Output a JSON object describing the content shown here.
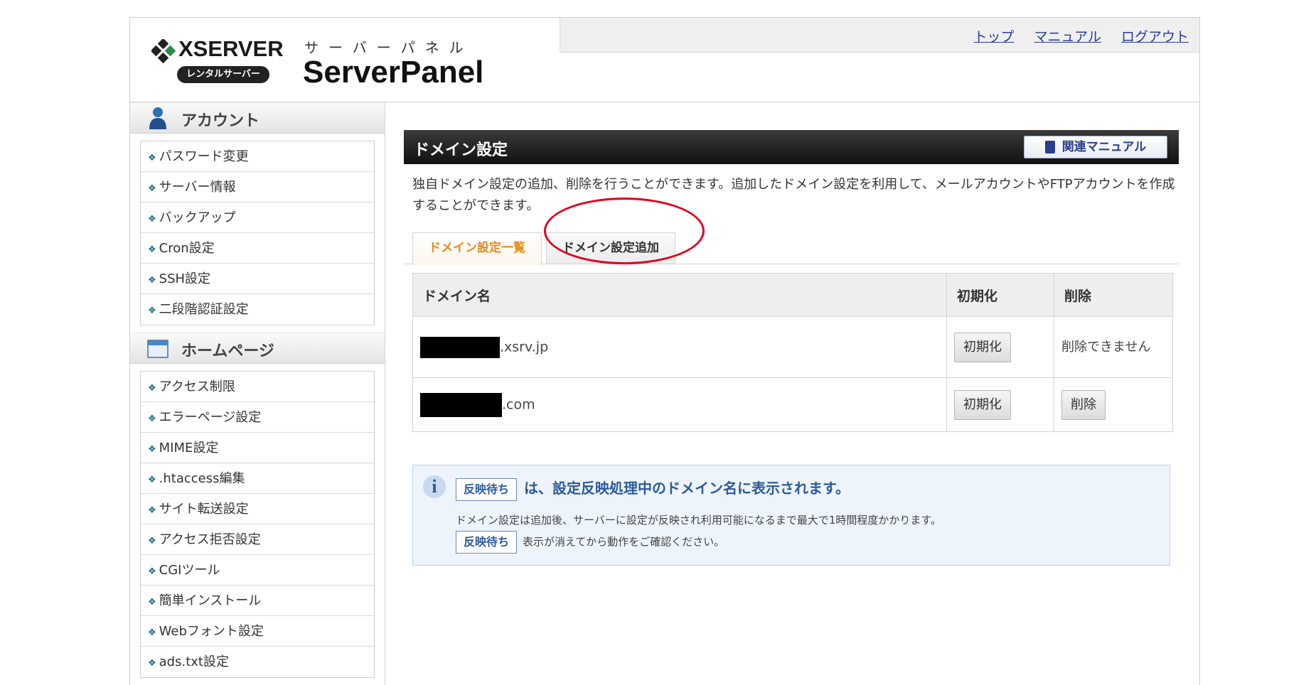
{
  "header": {
    "logo_brand": "XSERVER",
    "logo_badge": "レンタルサーバー",
    "panel_kana": "サーバーパネル",
    "panel_title": "ServerPanel",
    "links": [
      "トップ",
      "マニュアル",
      "ログアウト"
    ]
  },
  "sidebar": {
    "sections": [
      {
        "title": "アカウント",
        "icon": "user-icon",
        "items": [
          "パスワード変更",
          "サーバー情報",
          "バックアップ",
          "Cron設定",
          "SSH設定",
          "二段階認証設定"
        ]
      },
      {
        "title": "ホームページ",
        "icon": "homepage-icon",
        "items": [
          "アクセス制限",
          "エラーページ設定",
          "MIME設定",
          ".htaccess編集",
          "サイト転送設定",
          "アクセス拒否設定",
          "CGIツール",
          "簡単インストール",
          "Webフォント設定",
          "ads.txt設定"
        ]
      }
    ]
  },
  "main": {
    "title": "ドメイン設定",
    "manual_button": "関連マニュアル",
    "description": "独自ドメイン設定の追加、削除を行うことができます。追加したドメイン設定を利用して、メールアカウントやFTPアカウントを作成することができます。",
    "tabs": [
      {
        "label": "ドメイン設定一覧",
        "active": true
      },
      {
        "label": "ドメイン設定追加",
        "active": false
      }
    ],
    "table": {
      "headers": [
        "ドメイン名",
        "初期化",
        "削除"
      ],
      "rows": [
        {
          "domain_suffix": ".xsrv.jp",
          "init": "初期化",
          "delete_text": "削除できません",
          "delete_button": ""
        },
        {
          "domain_suffix": ".com",
          "init": "初期化",
          "delete_text": "",
          "delete_button": "削除"
        }
      ]
    },
    "info": {
      "badge": "反映待ち",
      "headline": "は、設定反映処理中のドメイン名に表示されます。",
      "line2": "ドメイン設定は追加後、サーバーに設定が反映され利用可能になるまで最大で1時間程度かかります。",
      "line3": "表示が消えてから動作をご確認ください。"
    }
  },
  "colors": {
    "accent_orange": "#e98a1e",
    "link_blue": "#2a3c9a",
    "annotation_red": "#e0001f",
    "info_blue": "#2c5a9a"
  }
}
